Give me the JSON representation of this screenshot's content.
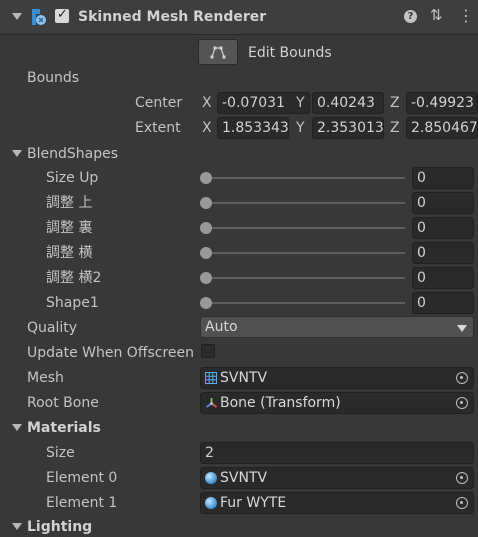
{
  "component": {
    "title": "Skinned Mesh Renderer",
    "enabled_check": "✓",
    "help_glyph": "?",
    "settings_glyph": "⇅",
    "menu_glyph": "⋮"
  },
  "edit_bounds": {
    "label": "Edit Bounds"
  },
  "bounds": {
    "label": "Bounds",
    "center": {
      "label": "Center",
      "x_label": "X",
      "x": "-0.07031",
      "y_label": "Y",
      "y": "0.40243",
      "z_label": "Z",
      "z": "-0.49923"
    },
    "extent": {
      "label": "Extent",
      "x_label": "X",
      "x": "1.853343",
      "y_label": "Y",
      "y": "2.353013",
      "z_label": "Z",
      "z": "2.850467"
    }
  },
  "blendshapes": {
    "label": "BlendShapes",
    "items": [
      {
        "label": "Size Up",
        "value": "0",
        "level": 0
      },
      {
        "label": "調整 上",
        "value": "0",
        "level": 0
      },
      {
        "label": "調整 裏",
        "value": "0",
        "level": 0
      },
      {
        "label": "調整 横",
        "value": "0",
        "level": 0
      },
      {
        "label": "調整 横2",
        "value": "0",
        "level": 0
      },
      {
        "label": "Shape1",
        "value": "0",
        "level": 0
      }
    ]
  },
  "quality": {
    "label": "Quality",
    "value": "Auto"
  },
  "update_offscreen": {
    "label": "Update When Offscreen",
    "checked": false
  },
  "mesh": {
    "label": "Mesh",
    "value": "SVNTV"
  },
  "root_bone": {
    "label": "Root Bone",
    "value": "Bone (Transform)"
  },
  "materials": {
    "label": "Materials",
    "size_label": "Size",
    "size_value": "2",
    "elements": [
      {
        "label": "Element 0",
        "value": "SVNTV"
      },
      {
        "label": "Element 1",
        "value": "Fur WYTE"
      }
    ]
  },
  "lighting": {
    "label": "Lighting"
  },
  "colors": {
    "background": "#383838",
    "field": "#2a2a2a",
    "text": "#c4c4c4",
    "accent_blue": "#4aa0d8"
  }
}
